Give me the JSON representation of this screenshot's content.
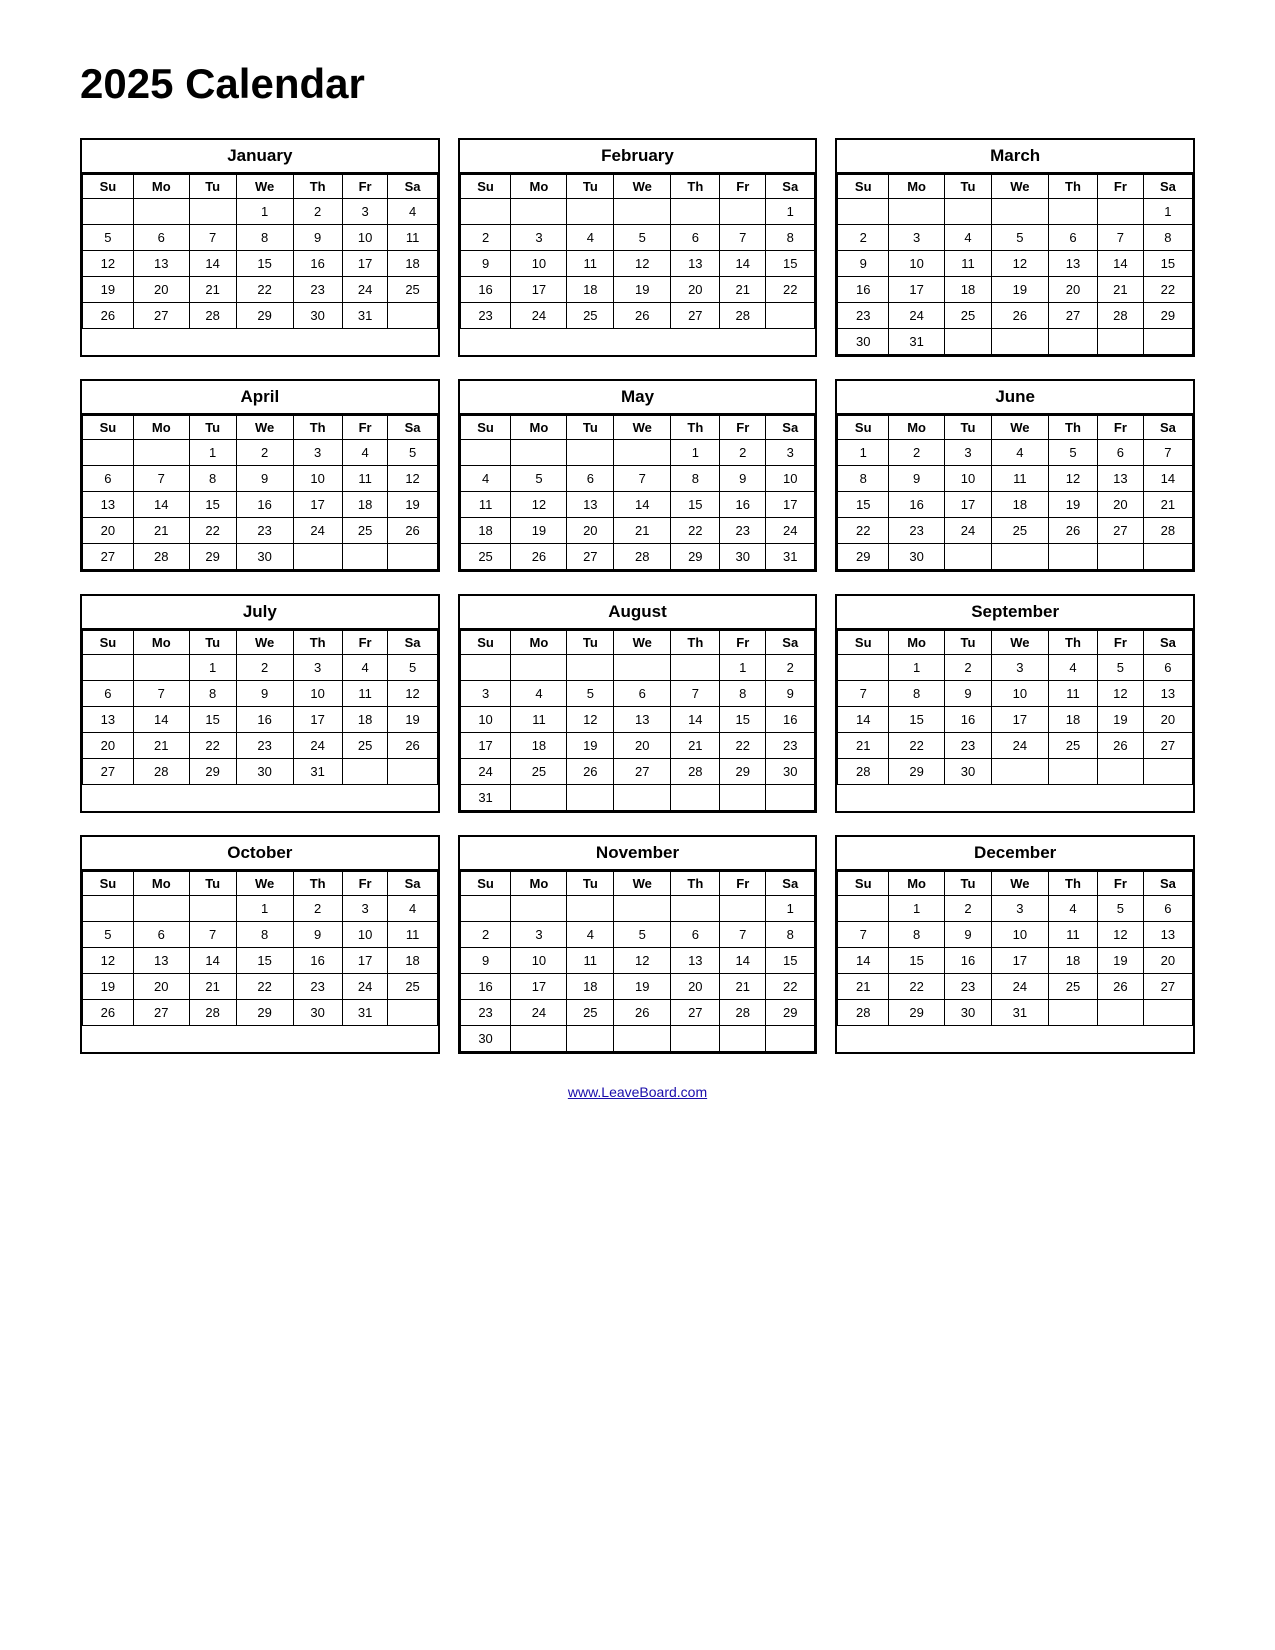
{
  "title": "2025 Calendar",
  "footer_link": "www.LeaveBoard.com",
  "days_header": [
    "Su",
    "Mo",
    "Tu",
    "We",
    "Th",
    "Fr",
    "Sa"
  ],
  "months": [
    {
      "name": "January",
      "weeks": [
        [
          "",
          "",
          "",
          "1",
          "2",
          "3",
          "4"
        ],
        [
          "5",
          "6",
          "7",
          "8",
          "9",
          "10",
          "11"
        ],
        [
          "12",
          "13",
          "14",
          "15",
          "16",
          "17",
          "18"
        ],
        [
          "19",
          "20",
          "21",
          "22",
          "23",
          "24",
          "25"
        ],
        [
          "26",
          "27",
          "28",
          "29",
          "30",
          "31",
          ""
        ]
      ]
    },
    {
      "name": "February",
      "weeks": [
        [
          "",
          "",
          "",
          "",
          "",
          "",
          "1"
        ],
        [
          "2",
          "3",
          "4",
          "5",
          "6",
          "7",
          "8"
        ],
        [
          "9",
          "10",
          "11",
          "12",
          "13",
          "14",
          "15"
        ],
        [
          "16",
          "17",
          "18",
          "19",
          "20",
          "21",
          "22"
        ],
        [
          "23",
          "24",
          "25",
          "26",
          "27",
          "28",
          ""
        ]
      ]
    },
    {
      "name": "March",
      "weeks": [
        [
          "",
          "",
          "",
          "",
          "",
          "",
          "1"
        ],
        [
          "2",
          "3",
          "4",
          "5",
          "6",
          "7",
          "8"
        ],
        [
          "9",
          "10",
          "11",
          "12",
          "13",
          "14",
          "15"
        ],
        [
          "16",
          "17",
          "18",
          "19",
          "20",
          "21",
          "22"
        ],
        [
          "23",
          "24",
          "25",
          "26",
          "27",
          "28",
          "29"
        ],
        [
          "30",
          "31",
          "",
          "",
          "",
          "",
          ""
        ]
      ]
    },
    {
      "name": "April",
      "weeks": [
        [
          "",
          "",
          "1",
          "2",
          "3",
          "4",
          "5"
        ],
        [
          "6",
          "7",
          "8",
          "9",
          "10",
          "11",
          "12"
        ],
        [
          "13",
          "14",
          "15",
          "16",
          "17",
          "18",
          "19"
        ],
        [
          "20",
          "21",
          "22",
          "23",
          "24",
          "25",
          "26"
        ],
        [
          "27",
          "28",
          "29",
          "30",
          "",
          "",
          ""
        ]
      ]
    },
    {
      "name": "May",
      "weeks": [
        [
          "",
          "",
          "",
          "",
          "1",
          "2",
          "3"
        ],
        [
          "4",
          "5",
          "6",
          "7",
          "8",
          "9",
          "10"
        ],
        [
          "11",
          "12",
          "13",
          "14",
          "15",
          "16",
          "17"
        ],
        [
          "18",
          "19",
          "20",
          "21",
          "22",
          "23",
          "24"
        ],
        [
          "25",
          "26",
          "27",
          "28",
          "29",
          "30",
          "31"
        ]
      ]
    },
    {
      "name": "June",
      "weeks": [
        [
          "1",
          "2",
          "3",
          "4",
          "5",
          "6",
          "7"
        ],
        [
          "8",
          "9",
          "10",
          "11",
          "12",
          "13",
          "14"
        ],
        [
          "15",
          "16",
          "17",
          "18",
          "19",
          "20",
          "21"
        ],
        [
          "22",
          "23",
          "24",
          "25",
          "26",
          "27",
          "28"
        ],
        [
          "29",
          "30",
          "",
          "",
          "",
          "",
          ""
        ]
      ]
    },
    {
      "name": "July",
      "weeks": [
        [
          "",
          "",
          "1",
          "2",
          "3",
          "4",
          "5"
        ],
        [
          "6",
          "7",
          "8",
          "9",
          "10",
          "11",
          "12"
        ],
        [
          "13",
          "14",
          "15",
          "16",
          "17",
          "18",
          "19"
        ],
        [
          "20",
          "21",
          "22",
          "23",
          "24",
          "25",
          "26"
        ],
        [
          "27",
          "28",
          "29",
          "30",
          "31",
          "",
          ""
        ]
      ]
    },
    {
      "name": "August",
      "weeks": [
        [
          "",
          "",
          "",
          "",
          "",
          "1",
          "2"
        ],
        [
          "3",
          "4",
          "5",
          "6",
          "7",
          "8",
          "9"
        ],
        [
          "10",
          "11",
          "12",
          "13",
          "14",
          "15",
          "16"
        ],
        [
          "17",
          "18",
          "19",
          "20",
          "21",
          "22",
          "23"
        ],
        [
          "24",
          "25",
          "26",
          "27",
          "28",
          "29",
          "30"
        ],
        [
          "31",
          "",
          "",
          "",
          "",
          "",
          ""
        ]
      ]
    },
    {
      "name": "September",
      "weeks": [
        [
          "",
          "1",
          "2",
          "3",
          "4",
          "5",
          "6"
        ],
        [
          "7",
          "8",
          "9",
          "10",
          "11",
          "12",
          "13"
        ],
        [
          "14",
          "15",
          "16",
          "17",
          "18",
          "19",
          "20"
        ],
        [
          "21",
          "22",
          "23",
          "24",
          "25",
          "26",
          "27"
        ],
        [
          "28",
          "29",
          "30",
          "",
          "",
          "",
          ""
        ]
      ]
    },
    {
      "name": "October",
      "weeks": [
        [
          "",
          "",
          "",
          "1",
          "2",
          "3",
          "4"
        ],
        [
          "5",
          "6",
          "7",
          "8",
          "9",
          "10",
          "11"
        ],
        [
          "12",
          "13",
          "14",
          "15",
          "16",
          "17",
          "18"
        ],
        [
          "19",
          "20",
          "21",
          "22",
          "23",
          "24",
          "25"
        ],
        [
          "26",
          "27",
          "28",
          "29",
          "30",
          "31",
          ""
        ]
      ]
    },
    {
      "name": "November",
      "weeks": [
        [
          "",
          "",
          "",
          "",
          "",
          "",
          "1"
        ],
        [
          "2",
          "3",
          "4",
          "5",
          "6",
          "7",
          "8"
        ],
        [
          "9",
          "10",
          "11",
          "12",
          "13",
          "14",
          "15"
        ],
        [
          "16",
          "17",
          "18",
          "19",
          "20",
          "21",
          "22"
        ],
        [
          "23",
          "24",
          "25",
          "26",
          "27",
          "28",
          "29"
        ],
        [
          "30",
          "",
          "",
          "",
          "",
          "",
          ""
        ]
      ]
    },
    {
      "name": "December",
      "weeks": [
        [
          "",
          "1",
          "2",
          "3",
          "4",
          "5",
          "6"
        ],
        [
          "7",
          "8",
          "9",
          "10",
          "11",
          "12",
          "13"
        ],
        [
          "14",
          "15",
          "16",
          "17",
          "18",
          "19",
          "20"
        ],
        [
          "21",
          "22",
          "23",
          "24",
          "25",
          "26",
          "27"
        ],
        [
          "28",
          "29",
          "30",
          "31",
          "",
          "",
          ""
        ]
      ]
    }
  ]
}
